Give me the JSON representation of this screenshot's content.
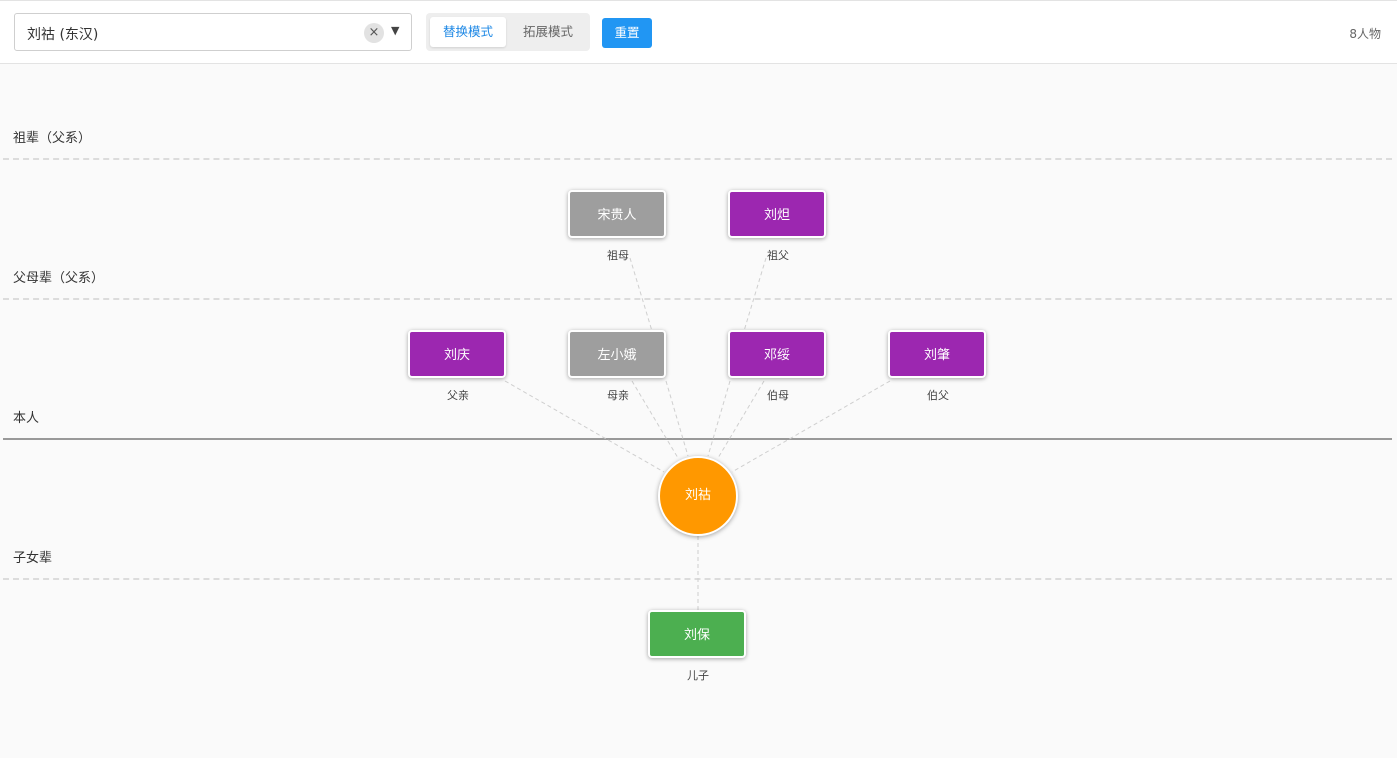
{
  "search": {
    "value": "刘祜 (东汉)",
    "clear_icon": "×",
    "dropdown_icon": "▼"
  },
  "modes": {
    "replace": "替换模式",
    "expand": "拓展模式",
    "active": "replace"
  },
  "reset_label": "重置",
  "count_label": "8人物",
  "generations": {
    "grandparents": "祖辈（父系）",
    "parents": "父母辈（父系）",
    "self": "本人",
    "children": "子女辈"
  },
  "people": {
    "grandmother": {
      "name": "宋贵人",
      "relation": "祖母"
    },
    "grandfather": {
      "name": "刘炟",
      "relation": "祖父"
    },
    "father": {
      "name": "刘庆",
      "relation": "父亲"
    },
    "mother": {
      "name": "左小娥",
      "relation": "母亲"
    },
    "aunt": {
      "name": "邓绥",
      "relation": "伯母"
    },
    "uncle": {
      "name": "刘肇",
      "relation": "伯父"
    },
    "self": {
      "name": "刘祜"
    },
    "son": {
      "name": "刘保",
      "relation": "儿子"
    }
  },
  "colors": {
    "male": "#9c27b0",
    "female": "#9e9e9e",
    "child": "#4caf50",
    "self": "#ff9800",
    "accent": "#2196f3"
  }
}
